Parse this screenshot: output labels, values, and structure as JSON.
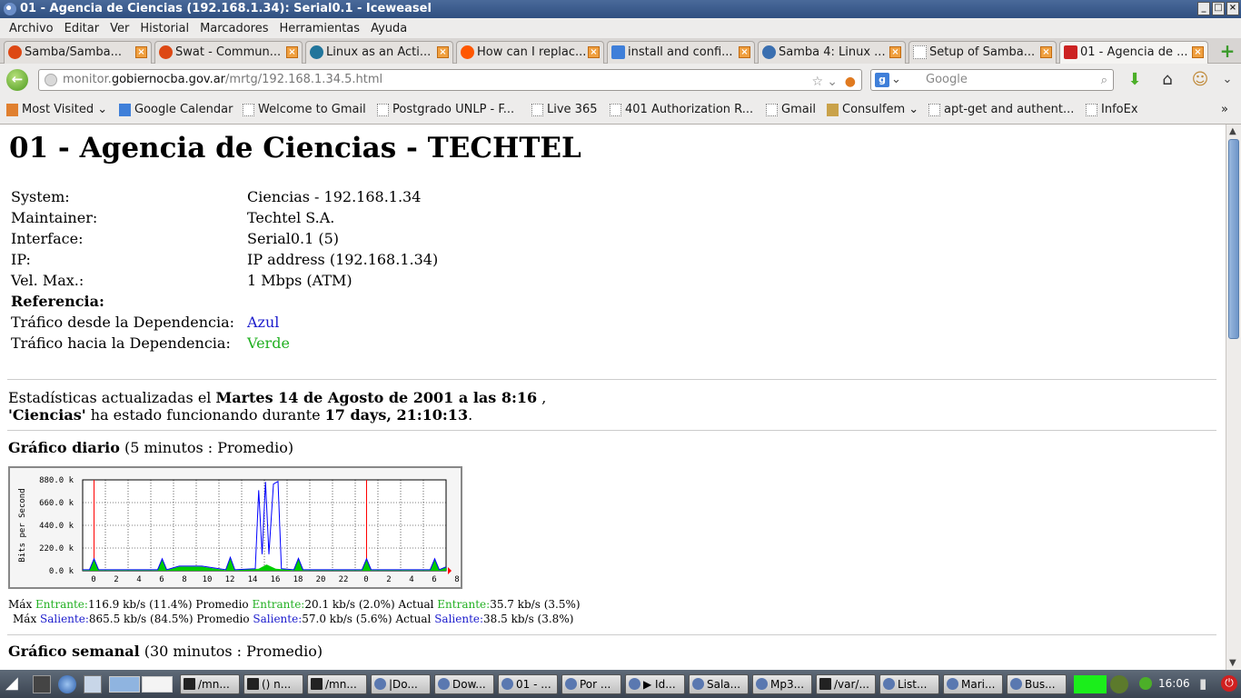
{
  "window": {
    "title": "01 - Agencia de Ciencias (192.168.1.34): Serial0.1 - Iceweasel"
  },
  "menu": [
    "Archivo",
    "Editar",
    "Ver",
    "Historial",
    "Marcadores",
    "Herramientas",
    "Ayuda"
  ],
  "tabs": [
    {
      "label": "Samba/Samba...",
      "icon": "ubuntu-icon",
      "color": "#dd4814"
    },
    {
      "label": "Swat - Commun...",
      "icon": "ubuntu-icon",
      "color": "#dd4814"
    },
    {
      "label": "Linux as an Acti...",
      "icon": "wordpress-icon",
      "color": "#21759b"
    },
    {
      "label": "How can I replac...",
      "icon": "reddit-icon",
      "color": "#ff5700"
    },
    {
      "label": "install and confi...",
      "icon": "google-icon",
      "color": "#3f7fd9"
    },
    {
      "label": "Samba 4: Linux ...",
      "icon": "site-icon",
      "color": "#3a6fb0"
    },
    {
      "label": "Setup of Samba...",
      "icon": "blank-page-icon",
      "color": "#ffffff"
    },
    {
      "label": "01 - Agencia de ...",
      "icon": "site-icon",
      "color": "#cc2222"
    }
  ],
  "nav": {
    "url_prefix": "monitor.",
    "url_host": "gobiernocba.gov.ar",
    "url_path": "/mrtg/192.168.1.34.5.html",
    "search_placeholder": "Google"
  },
  "bookmarks": [
    "Most Visited",
    "Google Calendar",
    "Welcome to Gmail",
    "Postgrado UNLP - F...",
    "Live 365",
    "401 Authorization R...",
    "Gmail",
    "Consulfem",
    "apt-get and authent...",
    "InfoEx"
  ],
  "page": {
    "title": "01 - Agencia de Ciencias - TECHTEL",
    "info": [
      {
        "k": "System:",
        "v": "Ciencias - 192.168.1.34"
      },
      {
        "k": "Maintainer:",
        "v": "Techtel S.A."
      },
      {
        "k": "Interface:",
        "v": "Serial0.1 (5)"
      },
      {
        "k": "IP:",
        "v": "IP address (192.168.1.34)"
      },
      {
        "k": "Vel. Max.:",
        "v": "1 Mbps (ATM)"
      }
    ],
    "ref_label": "Referencia:",
    "ref_from_label": "Tráfico desde la Dependencia:",
    "ref_from_value": "Azul",
    "ref_to_label": "Tráfico hacia la Dependencia:",
    "ref_to_value": "Verde",
    "stats_prefix": "Estadísticas actualizadas el ",
    "stats_date": "Martes 14 de Agosto de 2001 a las 8:16",
    "stats_comma": " ,",
    "uptime_name": "'Ciencias'",
    "uptime_mid": " ha estado funcionando durante ",
    "uptime_value": "17 days, 21:10:13",
    "uptime_end": ".",
    "daily_title": "Gráfico diario",
    "daily_sub": " (5 minutos : Promedio)",
    "weekly_title": "Gráfico semanal",
    "weekly_sub": " (30 minutos : Promedio)",
    "legend_in": {
      "max_label": "Máx ",
      "in_label": "Entrante:",
      "max": "116.9 kb/s (11.4%)",
      "avg_label": " Promedio ",
      "avg": "20.1 kb/s (2.0%)",
      "cur_label": " Actual ",
      "cur": "35.7 kb/s (3.5%)"
    },
    "legend_out": {
      "max_label": "Máx ",
      "out_label": "Saliente:",
      "max": "865.5 kb/s (84.5%)",
      "avg_label": "  Promedio ",
      "avg": "57.0 kb/s (5.6%)",
      "cur_label": "  Actual ",
      "cur": "38.5 kb/s (3.8%)"
    }
  },
  "chart_data": {
    "type": "area",
    "ylabel": "Bits per Second",
    "yticks": [
      "0.0 k",
      "220.0 k",
      "440.0 k",
      "660.0 k",
      "880.0 k"
    ],
    "ylim": [
      0,
      880
    ],
    "xticks": [
      "0",
      "2",
      "4",
      "6",
      "8",
      "10",
      "12",
      "14",
      "16",
      "18",
      "20",
      "22",
      "0",
      "2",
      "4",
      "6",
      "8"
    ],
    "series": [
      {
        "name": "Entrante",
        "color": "#00cc00",
        "x": [
          0,
          0.6,
          1,
          1.4,
          6.6,
          7,
          7.4,
          8.5,
          9.5,
          10.5,
          12.6,
          13,
          13.4,
          15.5,
          16.2,
          17,
          18.6,
          19,
          19.4,
          24.6,
          25,
          25.4,
          30.6,
          31,
          31.4,
          32
        ],
        "y": [
          5,
          5,
          110,
          5,
          5,
          110,
          5,
          40,
          40,
          40,
          5,
          120,
          5,
          20,
          60,
          20,
          5,
          120,
          5,
          5,
          110,
          5,
          5,
          110,
          5,
          35
        ]
      },
      {
        "name": "Saliente",
        "color": "#0000ff",
        "x": [
          0,
          0.6,
          1,
          1.4,
          6.6,
          7,
          7.4,
          8.5,
          9.5,
          10.5,
          12.6,
          13,
          13.4,
          15.2,
          15.5,
          15.8,
          16.1,
          16.4,
          16.8,
          17.2,
          17.5,
          18.6,
          19,
          19.4,
          24.6,
          25,
          25.4,
          30.6,
          31,
          31.4,
          32
        ],
        "y": [
          10,
          10,
          116,
          10,
          10,
          116,
          10,
          45,
          45,
          45,
          10,
          130,
          10,
          20,
          780,
          160,
          860,
          160,
          840,
          865,
          20,
          10,
          120,
          10,
          10,
          116,
          10,
          10,
          116,
          10,
          38
        ]
      }
    ]
  },
  "taskbar": [
    "/mn...",
    "() n...",
    "/mn...",
    "|Do...",
    "Dow...",
    "01 - ...",
    "Por ...",
    "▶ Id...",
    "Sala...",
    "Mp3...",
    "/var/...",
    "List...",
    "Mari...",
    "Bus..."
  ],
  "clock": "16:06"
}
